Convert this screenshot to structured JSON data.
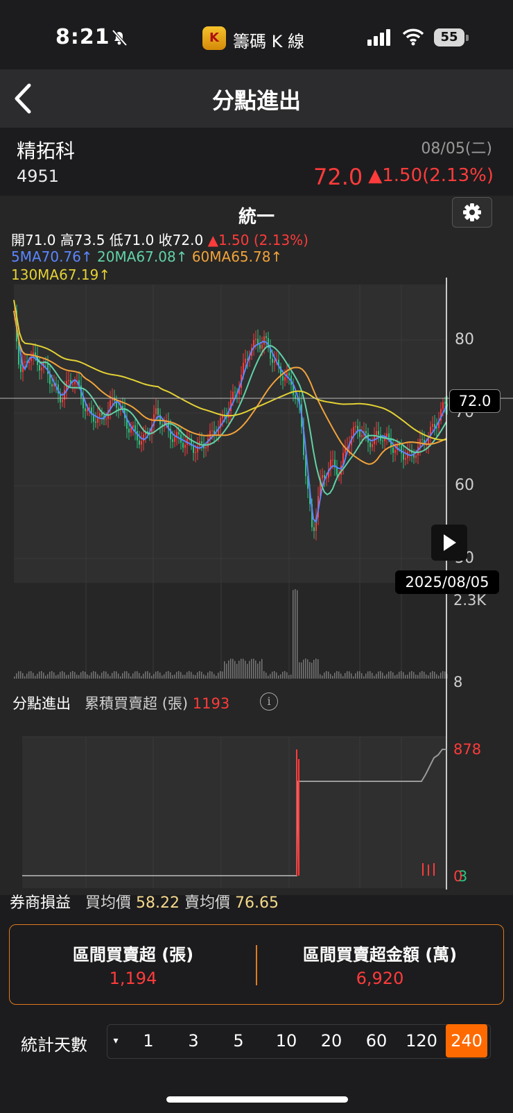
{
  "status": {
    "time": "8:21",
    "app_badge": "K",
    "app_name": "籌碼 K 線",
    "battery": "55"
  },
  "nav": {
    "title": "分點進出"
  },
  "stock": {
    "name": "精拓科",
    "code": "4951",
    "date": "08/05(二)",
    "price": "72.0",
    "change": "▲1.50(2.13%)"
  },
  "chart": {
    "title": "統一",
    "ohlc": {
      "open_label": "開",
      "open": "71.0",
      "high_label": "高",
      "high": "73.5",
      "low_label": "低",
      "low": "71.0",
      "close_label": "收",
      "close": "72.0",
      "change": "▲1.50 (2.13%)"
    },
    "ma": {
      "ma5": "5MA70.76↑",
      "ma20": "20MA67.08↑",
      "ma60": "60MA65.78↑",
      "ma130": "130MA67.19↑"
    },
    "price_axis": [
      "80",
      "70",
      "60",
      "50"
    ],
    "current_price_tag": "72.0",
    "date_tag": "2025/08/05",
    "volume_axis": [
      "2.3K",
      "8"
    ],
    "sub_title": "分點進出",
    "sub_metric_label": "累積買賣超 (張)",
    "sub_metric_value": "1193",
    "net_axis_top": "878",
    "net_axis_bottom_red": "0",
    "net_axis_bottom_green": "3",
    "colors": {
      "up": "#ff3b3b",
      "down": "#2ec27e",
      "ma5": "#5b86ff",
      "ma20": "#61d3a8",
      "ma60": "#f2a33a",
      "ma130": "#e4d235",
      "accent": "#ff6a00"
    }
  },
  "broker": {
    "label": "券商損益",
    "buy_avg_label": "買均價",
    "buy_avg": "58.22",
    "sell_avg_label": "賣均價",
    "sell_avg": "76.65"
  },
  "summary": {
    "left_label": "區間買賣超 (張)",
    "left_value": "1,194",
    "right_label": "區間買賣超金額 (萬)",
    "right_value": "6,920"
  },
  "days": {
    "label": "統計天數",
    "dropdown": "▾",
    "options": [
      "1",
      "3",
      "5",
      "10",
      "20",
      "60",
      "120",
      "240"
    ],
    "selected": "240"
  }
}
